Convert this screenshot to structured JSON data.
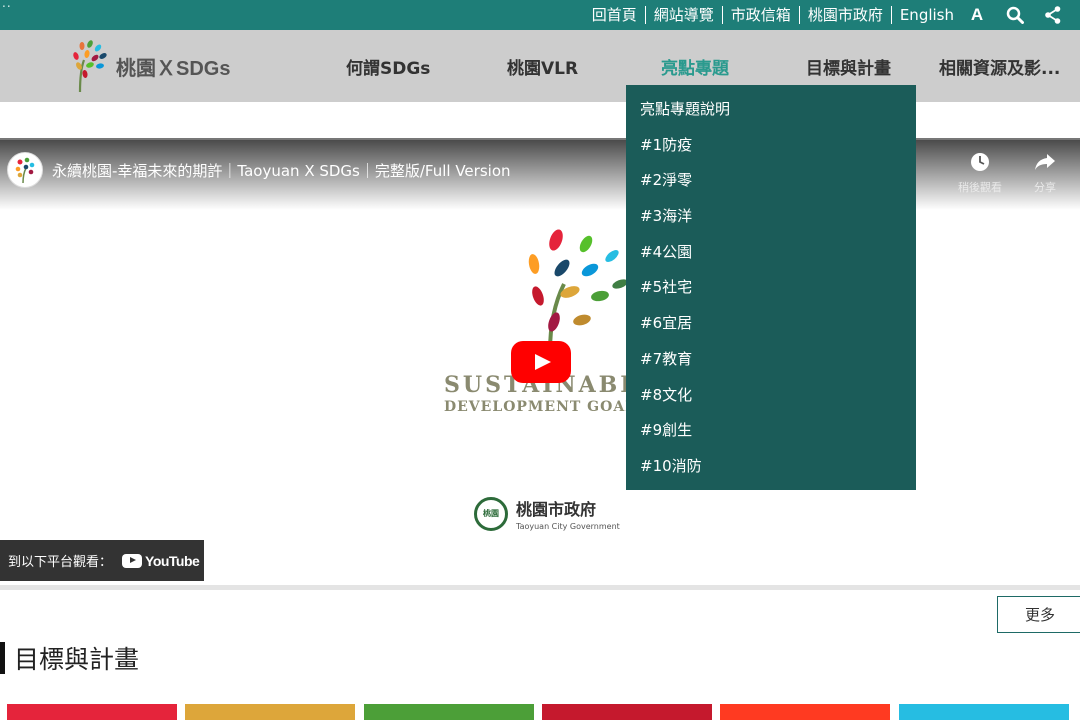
{
  "topbar": {
    "corner": "..",
    "links": [
      "回首頁",
      "網站導覽",
      "市政信箱",
      "桃園市政府",
      "English"
    ],
    "tools": {
      "font_size": "A",
      "search_icon": "search-icon",
      "share_icon": "share-icon"
    }
  },
  "nav": {
    "logo_text": "桃園ＸSDGs",
    "items": [
      "何謂SDGs",
      "桃園VLR",
      "亮點專題",
      "目標與計畫",
      "相關資源及影..."
    ],
    "active_index": 2,
    "active_color": "#2a9a8e"
  },
  "dropdown": {
    "items": [
      "亮點專題說明",
      "#1防疫",
      "#2淨零",
      "#3海洋",
      "#4公園",
      "#5社宅",
      "#6宜居",
      "#7教育",
      "#8文化",
      "#9創生",
      "#10消防"
    ],
    "background": "#1b5c59"
  },
  "video": {
    "title": "永續桃園-幸福未來的期許｜Taoyuan X SDGs｜完整版/Full Version",
    "watch_later": "稍後觀看",
    "share": "分享",
    "sdg_line1": "SUSTAINABLE",
    "sdg_line2": "DEVELOPMENT GOALS",
    "gov_zh": "桃園市政府",
    "gov_en": "Taoyuan City Government",
    "gov_seal": "桃園",
    "watch_on": "到以下平台觀看：",
    "youtube": "YouTube"
  },
  "more_button": "更多",
  "section": {
    "title": "目標與計畫"
  },
  "goal_colors": [
    "#e5243b",
    "#dda63a",
    "#4c9f38",
    "#c5192d",
    "#ff3a21",
    "#26bde2"
  ],
  "colors": {
    "topbar": "#1e7e78",
    "navbar": "#cdcdcd"
  }
}
